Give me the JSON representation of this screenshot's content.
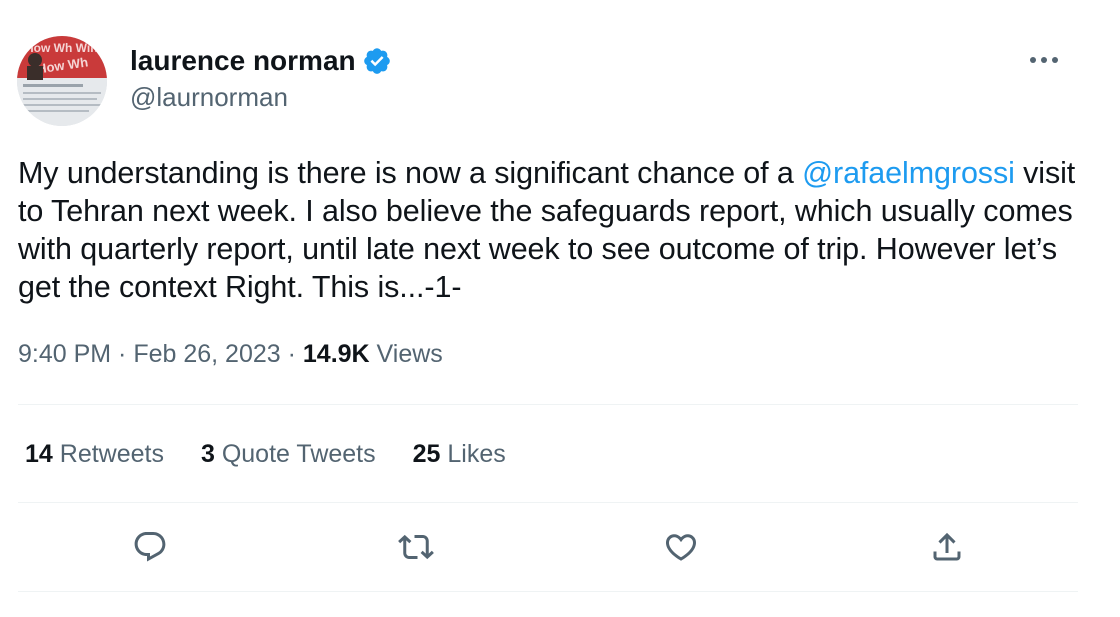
{
  "tweet": {
    "author": {
      "display_name": "laurence norman",
      "handle": "@laurnorman",
      "verified_icon": "verified-badge-icon",
      "avatar_text": "How Wh Wind"
    },
    "text_before": "My understanding is there is now a significant chance of a ",
    "mention": "@rafaelmgrossi",
    "text_after": " visit to Tehran next week. I also believe the safeguards report, which usually comes with quarterly report, until late next week to see outcome of trip. However let’s get the context Right. This is...-1-",
    "time": "9:40 PM",
    "separator": " · ",
    "date": "Feb 26, 2023",
    "views_count": "14.9K",
    "views_label": " Views"
  },
  "stats": {
    "retweets_count": "14",
    "retweets_label": " Retweets",
    "quotes_count": "3",
    "quotes_label": " Quote Tweets",
    "likes_count": "25",
    "likes_label": " Likes"
  },
  "actions": [
    "reply-icon",
    "retweet-icon",
    "like-icon",
    "share-icon"
  ],
  "colors": {
    "accent": "#1d9bf0",
    "text": "#0f1419",
    "secondary": "#536471",
    "divider": "#eff3f4"
  }
}
